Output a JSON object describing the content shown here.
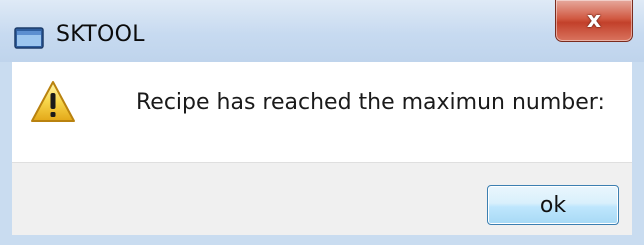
{
  "window": {
    "title": "SKTOOL",
    "close_glyph": "x"
  },
  "dialog": {
    "message": "Recipe has reached the maximun number:",
    "icon": "warning-icon"
  },
  "buttons": {
    "ok_label": "ok"
  },
  "colors": {
    "frame": "#c9dcf0",
    "close_button": "#c94a33",
    "ok_button_border": "#3c7fb1",
    "footer_bg": "#f0f0f0"
  }
}
